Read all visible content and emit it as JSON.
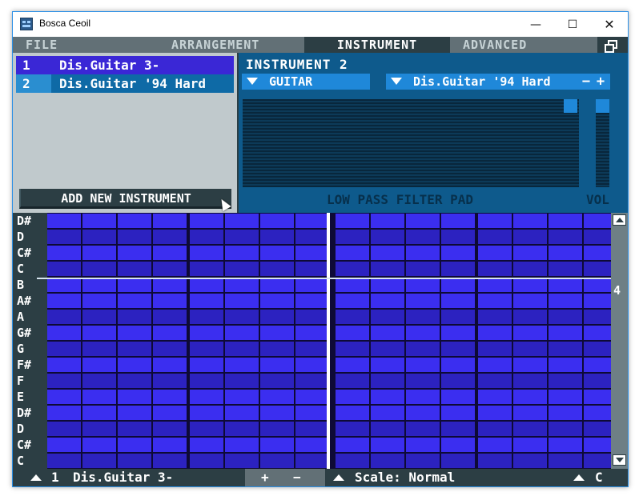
{
  "window": {
    "title": "Bosca Ceoil",
    "minimize": "—",
    "maximize": "☐",
    "close": "✕"
  },
  "menu": {
    "file": "FILE",
    "arrangement": "ARRANGEMENT",
    "instrument": "INSTRUMENT",
    "advanced": "ADVANCED"
  },
  "instruments": [
    {
      "num": "1",
      "name": "Dis.Guitar 3-"
    },
    {
      "num": "2",
      "name": "Dis.Guitar '94 Hard"
    }
  ],
  "add_button": "ADD NEW INSTRUMENT",
  "editor": {
    "title": "INSTRUMENT 2",
    "category": "GUITAR",
    "voice": "Dis.Guitar '94 Hard",
    "minus": "−",
    "plus": "+",
    "filter_label": "LOW PASS FILTER PAD",
    "vol_label": "VOL"
  },
  "notes": [
    "D#",
    "D",
    "C#",
    "C",
    "B",
    "A#",
    "A",
    "G#",
    "G",
    "F#",
    "F",
    "E",
    "D#",
    "D",
    "C#",
    "C"
  ],
  "octave": "4",
  "bottom": {
    "instrument_num": "1",
    "instrument_name": "Dis.Guitar 3-",
    "zoom_in": "+",
    "zoom_out": "−",
    "scale": "Scale: Normal",
    "key": "C"
  },
  "colors": {
    "cell_light": "#3b2ef0",
    "cell_dark": "#2c22c0",
    "selected_row": "#3a27d6",
    "accent": "#1f88d9"
  }
}
